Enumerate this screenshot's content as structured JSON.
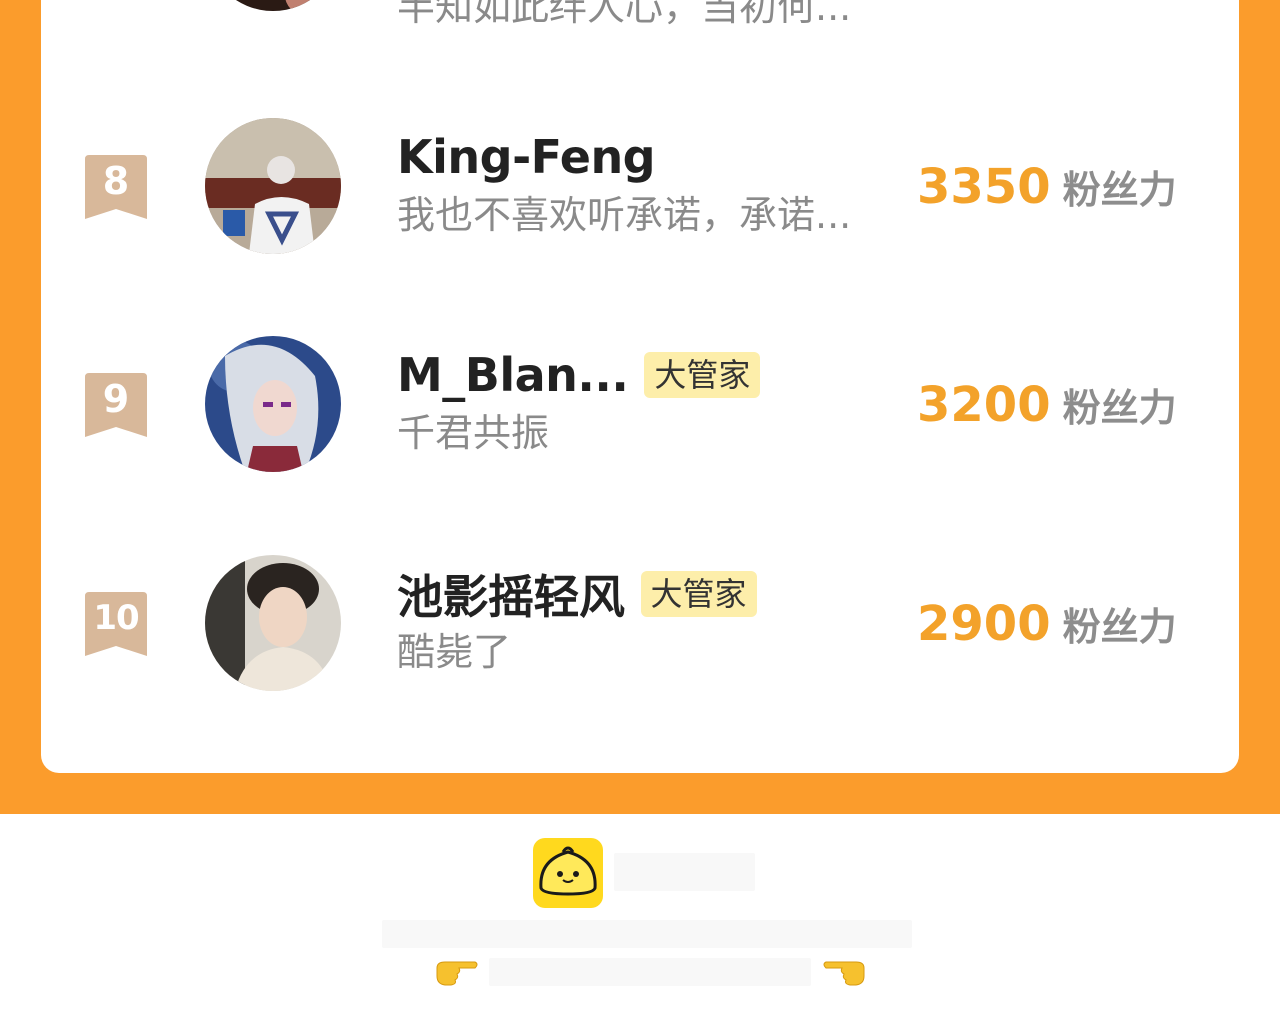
{
  "ranking": {
    "unit_label": "粉丝力",
    "tag_label": "大管家",
    "partial_row": {
      "motto": "半知如此绊人心，当初何..."
    },
    "rows": [
      {
        "rank": "8",
        "name": "King-Feng",
        "motto": "我也不喜欢听承诺，承诺...",
        "score": "3350",
        "has_tag": false
      },
      {
        "rank": "9",
        "name": "M_Blan...",
        "motto": "千君共振",
        "score": "3200",
        "has_tag": true
      },
      {
        "rank": "10",
        "name": "池影摇轻风",
        "motto": "酷毙了",
        "score": "2900",
        "has_tag": true
      }
    ]
  },
  "colors": {
    "frame": "#fb9c2c",
    "score": "#f3a22a",
    "badge": "#d8b89a",
    "tag_bg": "#fdeeaa",
    "logo": "#ffd91e"
  },
  "footer": {
    "logo_icon": "bun-mascot-icon",
    "left_pointer_icon": "pointing-right-hand-icon",
    "right_pointer_icon": "pointing-left-hand-icon"
  }
}
